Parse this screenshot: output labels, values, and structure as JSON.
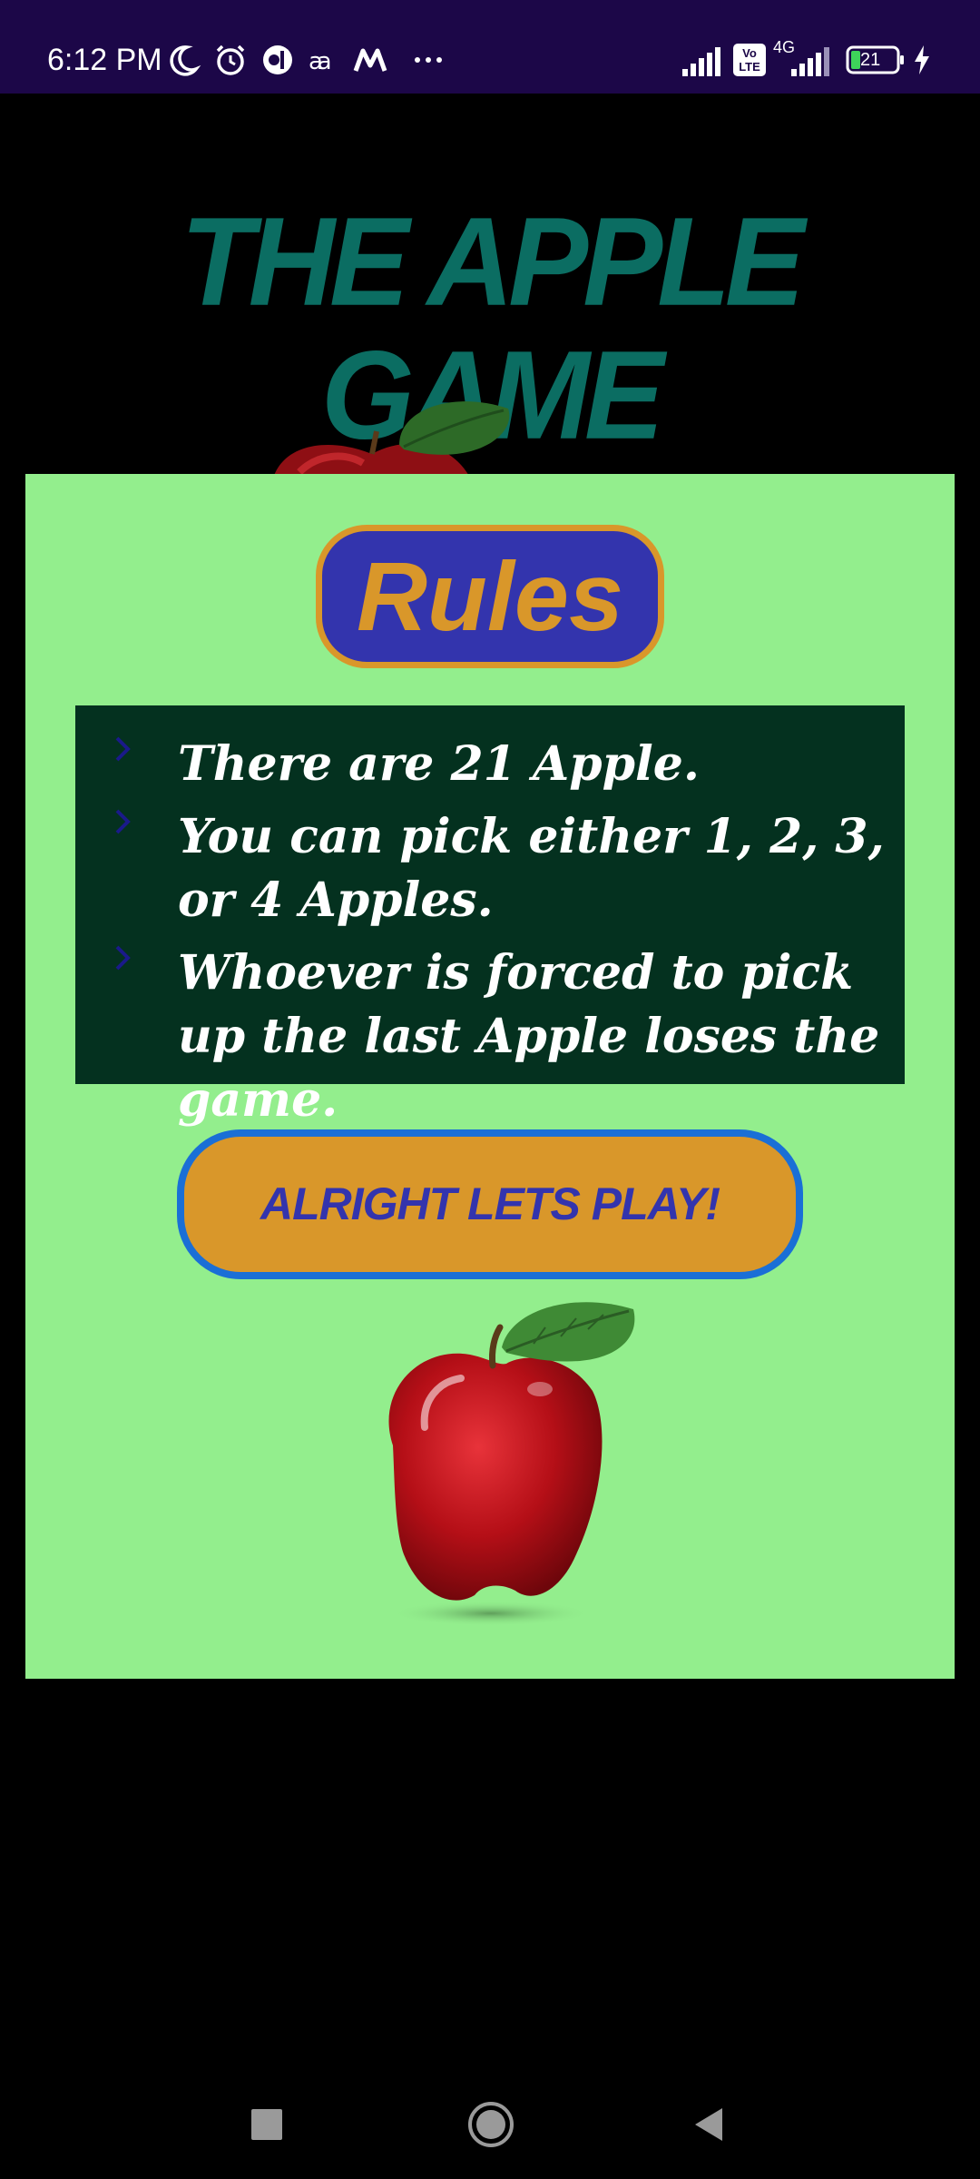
{
  "status_bar": {
    "time": "6:12 PM",
    "left_icons": [
      "moon-icon",
      "alarm-icon",
      "app-icon",
      "app-icon-2",
      "app-icon-3",
      "more-icon"
    ],
    "network": "4G",
    "volte": "Vo LTE",
    "battery_level": "21"
  },
  "app": {
    "title": "THE APPLE GAME"
  },
  "rules": {
    "heading": "Rules",
    "items": [
      "There are 21 Apple.",
      "You can pick either 1, 2, 3, or 4 Apples.",
      "Whoever is forced to pick up the last Apple loses the game."
    ]
  },
  "play_button": {
    "label": "ALRIGHT LETS PLAY!"
  },
  "colors": {
    "status_bar": "#1c0748",
    "title": "#0b6d62",
    "card": "#93ee8d",
    "rules_box": "#04311f",
    "badge_fill": "#3334ad",
    "badge_accent": "#d9972a",
    "button_border": "#1a6fd6"
  },
  "nav_bar": {
    "buttons": [
      "recents-button",
      "home-button",
      "back-button"
    ]
  }
}
